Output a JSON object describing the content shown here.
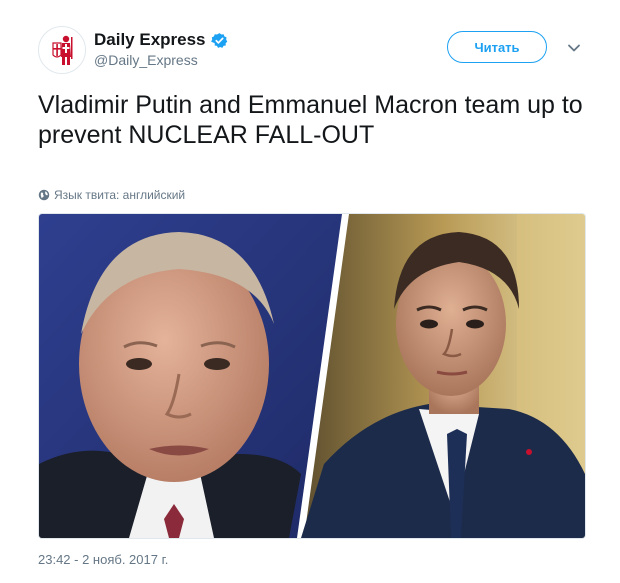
{
  "tweet": {
    "author": {
      "display_name": "Daily Express",
      "handle": "@Daily_Express",
      "verified": true,
      "avatar_icon": "crusader-logo-icon"
    },
    "follow_label": "Читать",
    "menu_icon": "chevron-down-icon",
    "text": "Vladimir Putin and Emmanuel Macron team up to prevent NUCLEAR FALL-OUT",
    "language_note": "Язык твита: английский",
    "image_alt": "Vladimir Putin and Emmanuel Macron side by side",
    "timestamp": "23:42 - 2 нояб. 2017 г."
  },
  "colors": {
    "accent": "#1da1f2",
    "secondary_text": "#657786",
    "brand_red": "#c8102e"
  }
}
